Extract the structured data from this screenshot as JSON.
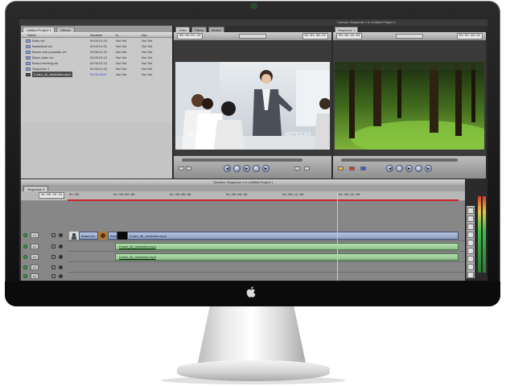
{
  "browser": {
    "tabs": [
      "Untitled Project 1",
      "Effects"
    ],
    "columns": [
      "Name",
      "Duration",
      "In",
      "Out"
    ],
    "rows": [
      {
        "type": "bin",
        "name": "Baby vid",
        "duration": "00:00:01:24",
        "in": "Not Set",
        "out": "Not Set"
      },
      {
        "type": "bin",
        "name": "Basketball vid",
        "duration": "00:00:01:31",
        "in": "Not Set",
        "out": "Not Set"
      },
      {
        "type": "bin",
        "name": "Beach and parasails vid",
        "duration": "00:00:01:22",
        "in": "Not Set",
        "out": "Not Set"
      },
      {
        "type": "bin",
        "name": "Black clubs vid",
        "duration": "00:00:01:13",
        "in": "Not Set",
        "out": "Not Set"
      },
      {
        "type": "bin",
        "name": "Board meeting vid",
        "duration": "00:00:01:24",
        "in": "Not Set",
        "out": "Not Set"
      },
      {
        "type": "bin",
        "name": "Sequence 1",
        "duration": "00:00:01:24",
        "in": "Not Set",
        "out": "Not Set"
      },
      {
        "type": "clip",
        "name": "2.sam_4k_resolution.mp4",
        "duration": "00:00:19:07",
        "in": "Not Set",
        "out": "Not Set",
        "selected": true
      }
    ]
  },
  "viewer": {
    "tabs": [
      "Video",
      "Filters",
      "Motion"
    ],
    "timecode_left": "00:00:01:24",
    "timecode_right": "01:01:30:21"
  },
  "canvas": {
    "title": "Canvas: Sequence 1 in Untitled Project 1",
    "tabs": [
      "Sequence 1"
    ],
    "timecode_left": "00:00:43:03",
    "timecode_right": "01:01:40:21"
  },
  "timeline": {
    "title": "Timeline: Sequence 1 in Untitled Project 1",
    "sequence_tab": "Sequence 1",
    "timecode": "01:00:19:21",
    "ruler": [
      "01:00",
      "01:00:03:00",
      "01:00:06:00",
      "01:00:09:00",
      "01:00:12:00",
      "01:00:15:00"
    ],
    "video_tracks": [
      {
        "label": "V1"
      }
    ],
    "audio_tracks": [
      {
        "label": "A1"
      },
      {
        "label": "A2"
      },
      {
        "label": "A3"
      },
      {
        "label": "A4"
      }
    ],
    "video_clips": [
      {
        "name": "Board me"
      },
      {
        "name": "Bask"
      },
      {
        "name": "2.sam_4k_resolution.mp4"
      }
    ],
    "audio_clips": [
      {
        "name": "2.sam_4k_resolution.mp4"
      },
      {
        "name": "2.sam_4k_resolution.mp4"
      }
    ]
  },
  "colors": {
    "selection_blue": "#2c39d6",
    "render_bar": "#d2222c",
    "video_clip": "#8ba0c4",
    "audio_clip": "#8fc48a"
  },
  "icons": [
    "apple-logo-icon",
    "camera-icon",
    "bin-icon",
    "clip-icon",
    "play-icon",
    "lock-icon",
    "eye-icon"
  ]
}
